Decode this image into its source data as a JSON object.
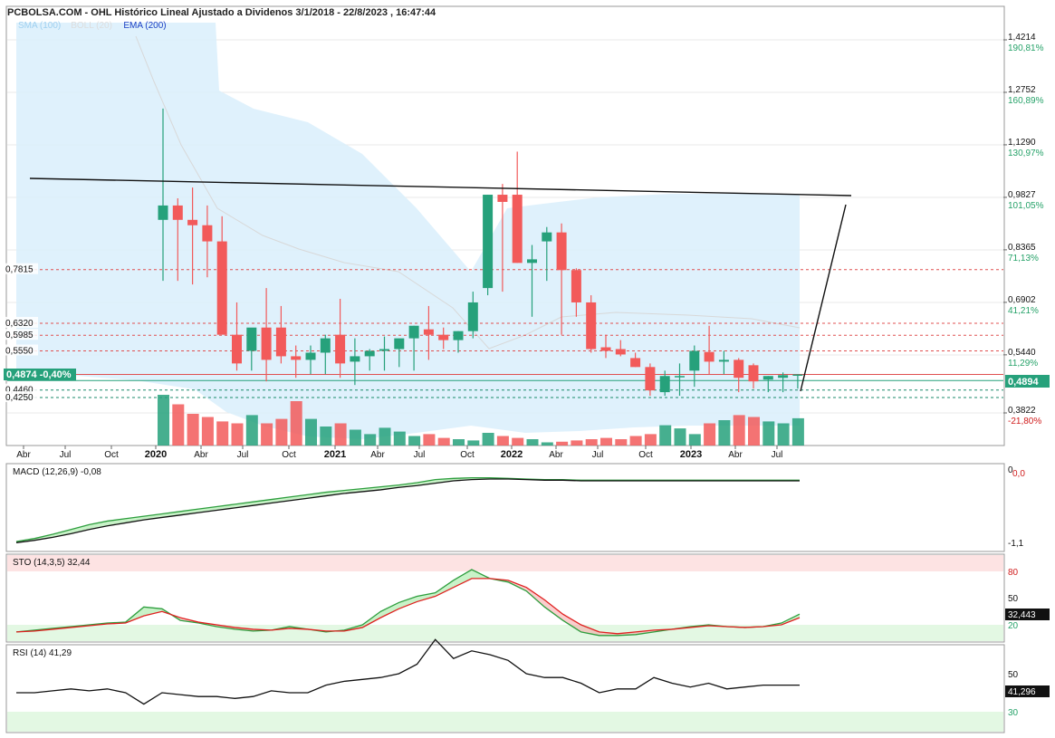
{
  "header": {
    "title": "PCBOLSA.COM - OHL Histórico Lineal Ajustado a Dividenos 3/1/2018 - 22/8/2023 , 16:47:44",
    "legend": [
      {
        "text": "SMA (100)",
        "color": "#9fd0f0"
      },
      {
        "text": "BOLL (20)",
        "color": "#dddddd"
      },
      {
        "text": "EMA (200)",
        "color": "#1a3fc4"
      }
    ]
  },
  "colors": {
    "up": "#26a17b",
    "down": "#f25a5a",
    "band": "#d9eefb",
    "grid": "#e8e8e8"
  },
  "chart_data": [
    {
      "type": "candlestick",
      "name": "price",
      "x": [
        "2020-01",
        "2020-02",
        "2020-03",
        "2020-04",
        "2020-05",
        "2020-06",
        "2020-07",
        "2020-08",
        "2020-09",
        "2020-10",
        "2020-11",
        "2020-12",
        "2021-01",
        "2021-02",
        "2021-03",
        "2021-04",
        "2021-05",
        "2021-06",
        "2021-07",
        "2021-08",
        "2021-09",
        "2021-10",
        "2021-11",
        "2021-12",
        "2022-01",
        "2022-02",
        "2022-03",
        "2022-04",
        "2022-05",
        "2022-06",
        "2022-07",
        "2022-08",
        "2022-09",
        "2022-10",
        "2022-11",
        "2022-12",
        "2023-01",
        "2023-02",
        "2023-03",
        "2023-04",
        "2023-05",
        "2023-06",
        "2023-07",
        "2023-08"
      ],
      "open": [
        0.92,
        0.96,
        0.92,
        0.905,
        0.86,
        0.6,
        0.555,
        0.62,
        0.62,
        0.54,
        0.53,
        0.55,
        0.6,
        0.525,
        0.54,
        0.555,
        0.56,
        0.59,
        0.615,
        0.6,
        0.585,
        0.61,
        0.73,
        0.99,
        0.99,
        0.8,
        0.86,
        0.885,
        0.78,
        0.69,
        0.565,
        0.56,
        0.535,
        0.51,
        0.44,
        0.485,
        0.5,
        0.552,
        0.525,
        0.53,
        0.515,
        0.475,
        0.48,
        0.4874
      ],
      "high": [
        1.23,
        0.98,
        1.01,
        0.96,
        0.93,
        0.69,
        0.6,
        0.73,
        0.68,
        0.57,
        0.57,
        0.6,
        0.7,
        0.59,
        0.56,
        0.595,
        0.585,
        0.625,
        0.68,
        0.62,
        0.61,
        0.72,
        0.99,
        1.02,
        1.11,
        0.85,
        0.9,
        0.91,
        0.785,
        0.71,
        0.6,
        0.585,
        0.55,
        0.52,
        0.5,
        0.52,
        0.57,
        0.625,
        0.555,
        0.535,
        0.52,
        0.485,
        0.495,
        0.49
      ],
      "low": [
        0.75,
        0.75,
        0.74,
        0.76,
        0.68,
        0.5,
        0.5,
        0.47,
        0.52,
        0.48,
        0.49,
        0.49,
        0.48,
        0.46,
        0.5,
        0.5,
        0.51,
        0.5,
        0.53,
        0.56,
        0.55,
        0.59,
        0.71,
        0.72,
        0.8,
        0.65,
        0.75,
        0.6,
        0.65,
        0.55,
        0.535,
        0.54,
        0.51,
        0.43,
        0.43,
        0.43,
        0.455,
        0.49,
        0.49,
        0.44,
        0.45,
        0.44,
        0.44,
        0.45
      ],
      "close": [
        0.96,
        0.92,
        0.905,
        0.86,
        0.6,
        0.52,
        0.62,
        0.53,
        0.54,
        0.53,
        0.55,
        0.59,
        0.52,
        0.54,
        0.555,
        0.56,
        0.59,
        0.625,
        0.6,
        0.585,
        0.61,
        0.69,
        0.99,
        0.97,
        0.8,
        0.81,
        0.885,
        0.78,
        0.69,
        0.56,
        0.555,
        0.545,
        0.51,
        0.445,
        0.485,
        0.485,
        0.555,
        0.525,
        0.53,
        0.48,
        0.47,
        0.485,
        0.4874,
        0.4894
      ]
    },
    {
      "type": "bar",
      "name": "volume",
      "values": [
        0.8,
        0.65,
        0.5,
        0.45,
        0.38,
        0.35,
        0.48,
        0.35,
        0.42,
        0.7,
        0.42,
        0.3,
        0.35,
        0.25,
        0.18,
        0.28,
        0.22,
        0.15,
        0.18,
        0.12,
        0.1,
        0.08,
        0.2,
        0.15,
        0.12,
        0.1,
        0.05,
        0.06,
        0.08,
        0.1,
        0.12,
        0.1,
        0.15,
        0.18,
        0.32,
        0.27,
        0.18,
        0.35,
        0.4,
        0.48,
        0.45,
        0.38,
        0.35,
        0.43
      ]
    }
  ],
  "price_axis": {
    "ticks": [
      {
        "price": "1,4214",
        "pct": "190,81%"
      },
      {
        "price": "1,2752",
        "pct": "160,89%"
      },
      {
        "price": "1,1290",
        "pct": "130,97%"
      },
      {
        "price": "0,9827",
        "pct": "101,05%"
      },
      {
        "price": "0,8365",
        "pct": "71,13%"
      },
      {
        "price": "0,6902",
        "pct": "41,21%"
      },
      {
        "price": "0,5440",
        "pct": "11,29%"
      },
      {
        "price": "0,3822",
        "pct": "-21,80%"
      }
    ],
    "current": "0,4894"
  },
  "level_labels": [
    "0,7815",
    "0,6320",
    "0,5985",
    "0,5550",
    "0,4460",
    "0,4250"
  ],
  "last_tag": "0,4874 -0,40%",
  "x_axis": {
    "labels": [
      {
        "text": "Abr",
        "year": false
      },
      {
        "text": "Jul",
        "year": false
      },
      {
        "text": "Oct",
        "year": false
      },
      {
        "text": "2020",
        "year": true
      },
      {
        "text": "Abr",
        "year": false
      },
      {
        "text": "Jul",
        "year": false
      },
      {
        "text": "Oct",
        "year": false
      },
      {
        "text": "2021",
        "year": true
      },
      {
        "text": "Abr",
        "year": false
      },
      {
        "text": "Jul",
        "year": false
      },
      {
        "text": "Oct",
        "year": false
      },
      {
        "text": "2022",
        "year": true
      },
      {
        "text": "Abr",
        "year": false
      },
      {
        "text": "Jul",
        "year": false
      },
      {
        "text": "Oct",
        "year": false
      },
      {
        "text": "2023",
        "year": true
      },
      {
        "text": "Abr",
        "year": false
      },
      {
        "text": "Jul",
        "year": false
      }
    ]
  },
  "macd": {
    "label": "MACD (12,26,9)",
    "value": "-0,08",
    "axis_top": "0",
    "axis_zero": "0,0",
    "axis_bottom": "-1,1",
    "macd_line": [
      -1.1,
      -1.05,
      -0.98,
      -0.9,
      -0.82,
      -0.76,
      -0.72,
      -0.68,
      -0.64,
      -0.6,
      -0.56,
      -0.52,
      -0.48,
      -0.44,
      -0.4,
      -0.36,
      -0.32,
      -0.28,
      -0.25,
      -0.22,
      -0.19,
      -0.16,
      -0.12,
      -0.07,
      -0.05,
      -0.04,
      -0.04,
      -0.05,
      -0.06,
      -0.07,
      -0.07,
      -0.08,
      -0.08,
      -0.08,
      -0.08,
      -0.08,
      -0.08,
      -0.08,
      -0.08,
      -0.08,
      -0.08,
      -0.08,
      -0.08,
      -0.08
    ],
    "signal_line": [
      -1.12,
      -1.08,
      -1.03,
      -0.97,
      -0.9,
      -0.84,
      -0.79,
      -0.74,
      -0.7,
      -0.66,
      -0.62,
      -0.58,
      -0.54,
      -0.5,
      -0.46,
      -0.42,
      -0.38,
      -0.34,
      -0.3,
      -0.27,
      -0.24,
      -0.2,
      -0.17,
      -0.13,
      -0.09,
      -0.07,
      -0.06,
      -0.06,
      -0.07,
      -0.08,
      -0.08,
      -0.09,
      -0.09,
      -0.09,
      -0.09,
      -0.09,
      -0.09,
      -0.09,
      -0.09,
      -0.09,
      -0.09,
      -0.09,
      -0.09,
      -0.09
    ]
  },
  "sto": {
    "label": "STO (14,3,5)",
    "value": "32,44",
    "axis_80": "80",
    "axis_50": "50",
    "axis_20": "20",
    "current": "32,443",
    "k_line": [
      12,
      14,
      16,
      18,
      20,
      22,
      23,
      40,
      38,
      25,
      22,
      18,
      15,
      13,
      14,
      18,
      15,
      12,
      14,
      20,
      35,
      45,
      52,
      56,
      70,
      82,
      72,
      68,
      58,
      40,
      25,
      12,
      8,
      8,
      9,
      12,
      15,
      18,
      20,
      18,
      17,
      18,
      22,
      32
    ],
    "d_line": [
      12,
      13,
      15,
      17,
      19,
      21,
      22,
      30,
      35,
      28,
      23,
      20,
      17,
      15,
      14,
      16,
      15,
      13,
      13,
      17,
      28,
      38,
      46,
      52,
      62,
      72,
      72,
      70,
      62,
      48,
      32,
      20,
      12,
      10,
      12,
      14,
      15,
      17,
      19,
      18,
      17,
      18,
      20,
      28
    ]
  },
  "rsi": {
    "label": "RSI (14)",
    "value": "41,29",
    "axis_50": "50",
    "axis_30": "30",
    "current": "41,296",
    "line": [
      40,
      40,
      41,
      42,
      41,
      42,
      40,
      34,
      40,
      39,
      38,
      38,
      37,
      38,
      41,
      40,
      40,
      44,
      46,
      47,
      48,
      50,
      55,
      68,
      58,
      62,
      60,
      57,
      50,
      48,
      48,
      45,
      40,
      42,
      42,
      48,
      45,
      43,
      45,
      42,
      43,
      44,
      44,
      44
    ]
  }
}
